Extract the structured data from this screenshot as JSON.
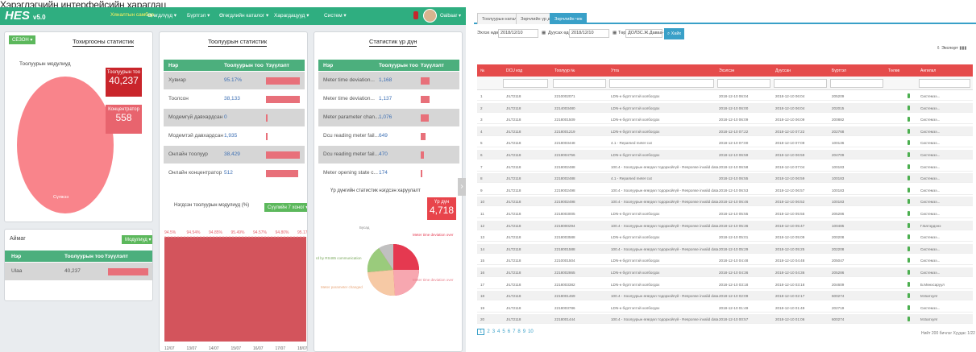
{
  "caption": "Хэрэглэгчийн интерфейсийн харагдац",
  "left": {
    "app_logo": "HES",
    "app_version": "v5.0",
    "nav": [
      "Хяналтын самбар",
      "Өгөгдлүүд ▾",
      "Бүртгэл ▾",
      "Өгөгдлийн каталог ▾",
      "Харагдацууд ▾",
      "Систем ▾"
    ],
    "user": "Oaibaar ▾",
    "panel1": {
      "dropdown": "СЕЗОН ▾",
      "title": "Тохиргооны статистик",
      "pie_label": "Тоолуурын модулиуд",
      "pie_slice_label": "Сүлжээ",
      "box1_label": "Тоолуурын тоо",
      "box1_value": "40,237",
      "box2_label": "Концентратор",
      "box2_value": "558"
    },
    "panel1b": {
      "title": "Аймаг",
      "dropdown": "Модулиуд ▾",
      "headers": [
        "Нэр",
        "Тоолуурын тоо",
        "Үзүүлэлт"
      ],
      "row": [
        "Ulaa",
        "40,237"
      ]
    },
    "panel2": {
      "title": "Тоолуурын статистик",
      "headers": [
        "Нэр",
        "Тоолуурын тоо",
        "Үзүүлэлт"
      ],
      "rows": [
        {
          "name": "Хувиар",
          "value": "95.17%",
          "pct": 0.95
        },
        {
          "name": "Тоолсон",
          "value": "38,133",
          "pct": 0.95
        },
        {
          "name": "Модемгүй давхардсан",
          "value": "0",
          "pct": 0.0
        },
        {
          "name": "Модемтэй давхардсан",
          "value": "1,935",
          "pct": 0.05
        },
        {
          "name": "Онлайн тоолуур",
          "value": "38,429",
          "pct": 0.95
        },
        {
          "name": "Онлайн концентратор",
          "value": "512",
          "pct": 0.92
        }
      ],
      "chart_title": "Нэгдсэн тоолуурын модулиуд (%)",
      "chart_dropdown": "Сүүлийн 7 хоног ▾",
      "top_labels": [
        "94.5%",
        "94.54%",
        "94.85%",
        "95.49%",
        "94.57%",
        "94.80%",
        "95.17%"
      ],
      "x_labels": [
        "12/07",
        "13/07",
        "14/07",
        "15/07",
        "16/07",
        "17/07",
        "18/07"
      ]
    },
    "panel3": {
      "title": "Статистик үр дүн",
      "headers": [
        "Нэр",
        "Тоолуурын тоо",
        "Үзүүлэлт"
      ],
      "rows": [
        {
          "name": "Meter time deviation...",
          "value": "1,168",
          "pct": 0.25
        },
        {
          "name": "Meter time deviation...",
          "value": "1,137",
          "pct": 0.24
        },
        {
          "name": "Meter parameter chan...",
          "value": "1,076",
          "pct": 0.23
        },
        {
          "name": "Dcu reading meter fail...",
          "value": "649",
          "pct": 0.14
        },
        {
          "name": "Dcu reading meter fail...",
          "value": "470",
          "pct": 0.1
        },
        {
          "name": "Meter opening state c...",
          "value": "174",
          "pct": 0.04
        }
      ],
      "chart_title": "Үр дүнгийн статистик нэгдсэн харуулалт",
      "box_label": "Үр дүн",
      "box_value": "4,718",
      "pie_labels": [
        "Бусад",
        "Meter time deviation over",
        "rd by RS485 communication",
        "Meter parameter changed",
        "Meter time deviation over"
      ]
    }
  },
  "right": {
    "tabs": [
      "Тоолуурын каталог",
      "Зөрчлийн үр дүн",
      "Зөрчлийн чек"
    ],
    "filter_start_label": "Эхлэх өдөр",
    "filter_start": "2018/12/10",
    "filter_end_label": "Дуусах өдөр",
    "filter_end": "2018/12/10",
    "filter_type_label": "Төрөл",
    "filter_type": "ДОЛЗС.Ж.Даваа-Шүр ▾",
    "search_label": "Хайх",
    "export_label": "Экспорт",
    "headers": [
      "№",
      "DCU код",
      "Тоолуур №",
      "Утга",
      "Эхэлсэн",
      "Дууссан",
      "Бүртгэл",
      "Төлөв",
      "Ангилал"
    ],
    "rows": [
      [
        "1",
        "JILT2118",
        "2210002071",
        "LDN-н бүртгэлтэй холбогдох",
        "2018-12-10 06:04",
        "2018-12-10 06:04",
        "205209",
        "Системээ..."
      ],
      [
        "2",
        "JILT2118",
        "2214003480",
        "LDN-н бүртгэлтэй холбогдох",
        "2018-12-10 06:00",
        "2018-12-10 06:04",
        "202015",
        "Системээ..."
      ],
      [
        "3",
        "JILT2118",
        "2218001509",
        "LDN-н бүртгэлтэй холбогдох",
        "2018-12-10 06:09",
        "2018-12-10 06:09",
        "200882",
        "Системээ..."
      ],
      [
        "4",
        "JILT2118",
        "2218001219",
        "LDN-н бүртгэлтэй холбогдох",
        "2018-12-10 07:22",
        "2018-12-10 07:22",
        "202768",
        "Системээ..."
      ],
      [
        "5",
        "JILT2118",
        "2218003448",
        "4.1 - Reparsed meter cut",
        "2018-12-10 07:00",
        "2018-12-10 07:09",
        "100136",
        "Системээ..."
      ],
      [
        "6",
        "JILT2118",
        "2219004756",
        "LDN-н бүртгэлтэй холбогдох",
        "2018-12-10 06:59",
        "2018-12-10 06:59",
        "204709",
        "Системээ..."
      ],
      [
        "7",
        "JILT2118",
        "2218002488",
        "100.4 - Хоолуурын өгөгдөл тодорхойгүй - Response invalid data",
        "2018-12-10 06:58",
        "2018-12-10 07:04",
        "100183",
        "Системээ..."
      ],
      [
        "8",
        "JILT2118",
        "2218002488",
        "4.1 - Reparsed meter cut",
        "2018-12-10 06:55",
        "2018-12-10 06:59",
        "100183",
        "Системээ..."
      ],
      [
        "9",
        "JILT2118",
        "2219002498",
        "100.4 - Хоолуурын өгөгдөл тодорхойгүй - Response invalid data",
        "2018-12-10 06:53",
        "2018-12-10 06:57",
        "100183",
        "Системээ..."
      ],
      [
        "10",
        "JILT2118",
        "2219002498",
        "100.4 - Хоолуурын өгөгдөл тодорхойгүй - Response invalid data",
        "2018-12-10 06:46",
        "2018-12-10 06:52",
        "100183",
        "Системээ..."
      ],
      [
        "11",
        "JILT2118",
        "2218003005",
        "LDN-н бүртгэлтэй холбогдох",
        "2018-12-10 05:55",
        "2018-12-10 05:55",
        "205286",
        "Системээ..."
      ],
      [
        "12",
        "JILT2118",
        "2218000294",
        "100.4 - Хоолуурын өгөгдөл тодорхойгүй - Response invalid data",
        "2018-12-10 05:36",
        "2018-12-10 05:47",
        "100485",
        "Г.Батэрдэнэ"
      ],
      [
        "13",
        "JILT2118",
        "2218003588",
        "LDN-н бүртгэлтэй холбогдох",
        "2018-12-10 05:01",
        "2018-12-10 05:09",
        "200208",
        "Системээ..."
      ],
      [
        "14",
        "JILT2118",
        "2218001588",
        "100.4 - Хоолуурын өгөгдөл тодорхойгүй - Response invalid data",
        "2018-12-10 05:29",
        "2018-12-10 05:25",
        "202208",
        "Системээ..."
      ],
      [
        "15",
        "JILT2118",
        "2210001504",
        "LDN-н бүртгэлтэй холбогдох",
        "2018-12-10 04:48",
        "2018-12-10 04:48",
        "205047",
        "Системээ..."
      ],
      [
        "16",
        "JILT2118",
        "2218002865",
        "LDN-н бүртгэлтэй холбогдох",
        "2018-12-10 04:36",
        "2018-12-10 04:36",
        "205286",
        "Системээ..."
      ],
      [
        "17",
        "JILT2118",
        "2218003382",
        "LDN-н бүртгэлтэй холбогдох",
        "2018-12-10 03:18",
        "2018-12-10 03:18",
        "204609",
        "Б.Мөнхсаруул"
      ],
      [
        "18",
        "JILT2118",
        "2218001469",
        "100.4 - Хоолуурын өгөгдөл тодорхойгүй - Response invalid data",
        "2018-12-10 02:09",
        "2018-12-10 02:17",
        "600274",
        "М.Батхуяг"
      ],
      [
        "19",
        "JILT2118",
        "2218003786",
        "LDN-н бүртгэлтэй холбогдох",
        "2018-12-10 01:49",
        "2018-12-10 01:49",
        "202719",
        "Системээ..."
      ],
      [
        "20",
        "JILT2118",
        "2218001444",
        "100.4 - Хоолуурын өгөгдөл тодорхойгүй - Response invalid data",
        "2018-12-10 00:57",
        "2018-12-10 01:06",
        "600274",
        "М.Батхуяг"
      ]
    ],
    "pager": [
      "1",
      "2",
      "3",
      "4",
      "5",
      "6",
      "7",
      "8",
      "9",
      "10"
    ],
    "pager_info": "Нийт 200 бичлэг Хуудас 1/22"
  }
}
